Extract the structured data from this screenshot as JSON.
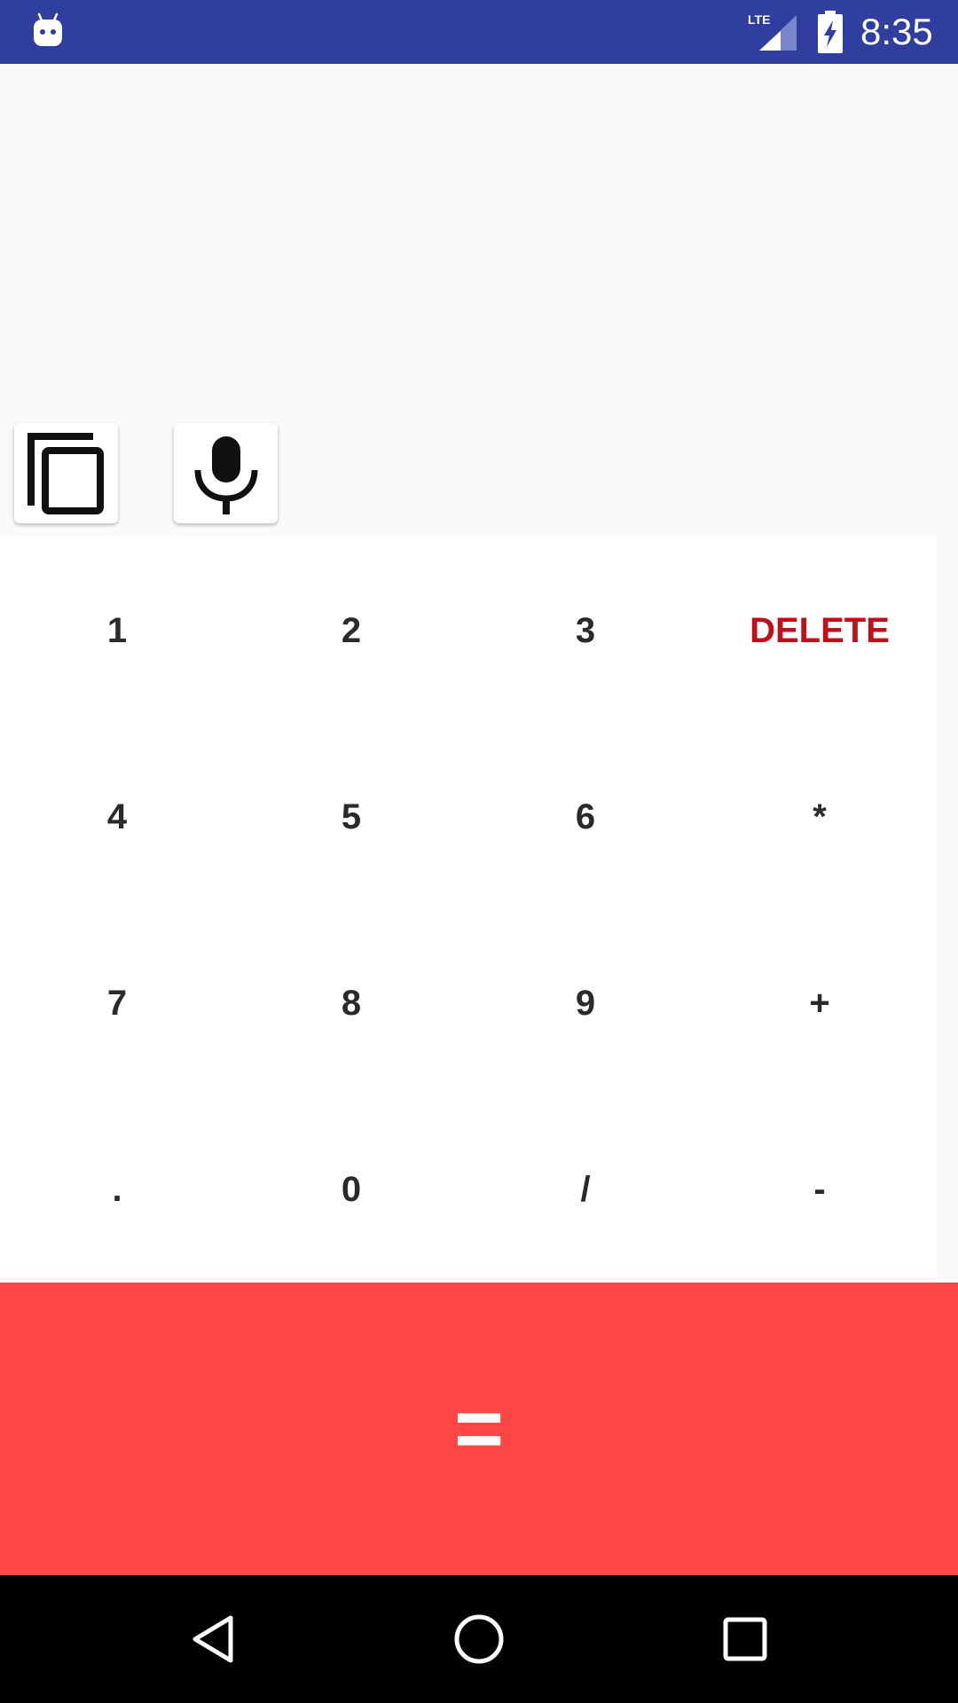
{
  "status_bar": {
    "time": "8:35",
    "network": "LTE",
    "bg_color": "#303f9f",
    "icons": [
      "android-icon",
      "lte-signal-icon",
      "battery-charging-icon"
    ]
  },
  "display": {
    "copy_button_icon": "copy-icon",
    "mic_button_icon": "microphone-icon"
  },
  "keypad": {
    "keys": [
      {
        "label": "1"
      },
      {
        "label": "2"
      },
      {
        "label": "3"
      },
      {
        "label": "DELETE"
      },
      {
        "label": "4"
      },
      {
        "label": "5"
      },
      {
        "label": "6"
      },
      {
        "label": "*"
      },
      {
        "label": "7"
      },
      {
        "label": "8"
      },
      {
        "label": "9"
      },
      {
        "label": "+"
      },
      {
        "label": "."
      },
      {
        "label": "0"
      },
      {
        "label": "/"
      },
      {
        "label": "-"
      }
    ],
    "delete_color": "#c0101a",
    "key_color": "#2a2a2a"
  },
  "equals": {
    "label": "=",
    "bg_color": "#ff4646"
  },
  "nav_bar": {
    "icons": [
      "back-icon",
      "home-icon",
      "recents-icon"
    ]
  }
}
